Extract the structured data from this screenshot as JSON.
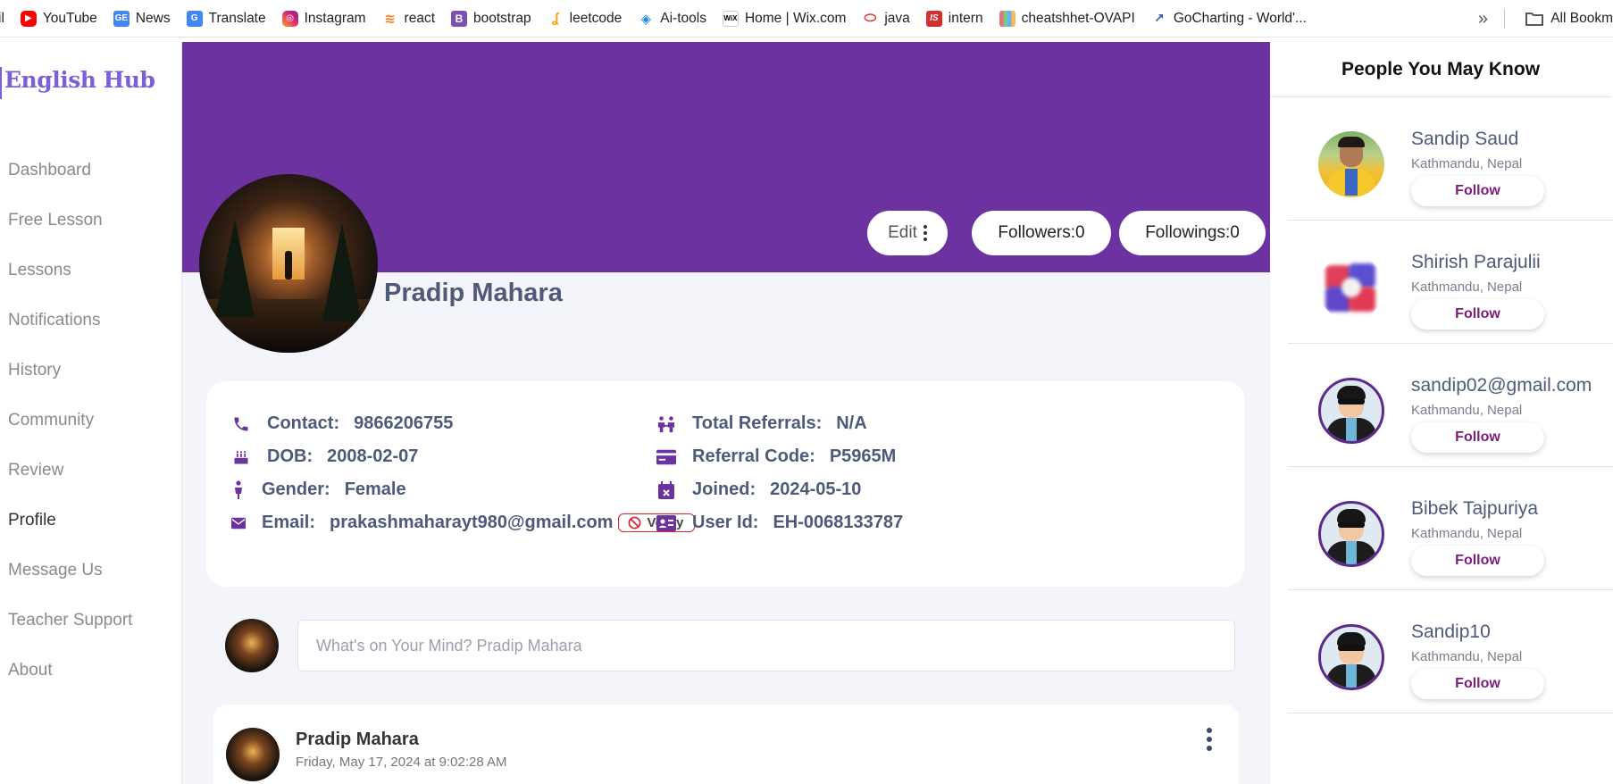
{
  "bookmarks": {
    "items": [
      {
        "label": "il",
        "icon": "mail-icon"
      },
      {
        "label": "YouTube",
        "icon": "youtube-icon",
        "color": "#ff0000"
      },
      {
        "label": "News",
        "icon": "news-icon",
        "color": "#4285f4"
      },
      {
        "label": "Translate",
        "icon": "translate-icon",
        "color": "#4285f4"
      },
      {
        "label": "Instagram",
        "icon": "instagram-icon",
        "color": "#e1306c"
      },
      {
        "label": "react",
        "icon": "stackoverflow-icon",
        "color": "#f48024"
      },
      {
        "label": "bootstrap",
        "icon": "bootstrap-icon",
        "color": "#7952b3"
      },
      {
        "label": "leetcode",
        "icon": "leetcode-icon",
        "color": "#ffa116"
      },
      {
        "label": "Ai-tools",
        "icon": "diamond-icon",
        "color": "#1e88e5"
      },
      {
        "label": "Home | Wix.com",
        "icon": "wix-icon",
        "color": "#000000"
      },
      {
        "label": "java",
        "icon": "oracle-icon",
        "color": "#e53935"
      },
      {
        "label": "intern",
        "icon": "is-icon",
        "color": "#d32f2f"
      },
      {
        "label": "cheatshhet-OVAPI",
        "icon": "bars-icon",
        "color": "#8e6c3f"
      },
      {
        "label": "GoCharting - World'...",
        "icon": "chart-icon",
        "color": "#3f51b5"
      }
    ],
    "all_bookmarks": "All Bookm"
  },
  "sidebar": {
    "logo": "English Hub",
    "items": [
      {
        "label": "Dashboard"
      },
      {
        "label": "Free Lesson"
      },
      {
        "label": "Lessons"
      },
      {
        "label": "Notifications"
      },
      {
        "label": "History"
      },
      {
        "label": "Community"
      },
      {
        "label": "Review"
      },
      {
        "label": "Profile",
        "active": true
      },
      {
        "label": "Message Us"
      },
      {
        "label": "Teacher Support"
      },
      {
        "label": "About"
      }
    ]
  },
  "profile": {
    "name": "Pradip Mahara",
    "edit_label": "Edit",
    "followers_label": "Followers:0",
    "followings_label": "Followings:0",
    "banner_color": "#6b32a0"
  },
  "info": {
    "contact": {
      "label": "Contact:",
      "value": "9866206755"
    },
    "dob": {
      "label": "DOB:",
      "value": "2008-02-07"
    },
    "gender": {
      "label": "Gender:",
      "value": "Female"
    },
    "email": {
      "label": "Email:",
      "value": "prakashmaharayt980@gmail.com"
    },
    "verify": "Verify",
    "referrals": {
      "label": "Total Referrals:",
      "value": "N/A"
    },
    "referral_code": {
      "label": "Referral Code:",
      "value": "P5965M"
    },
    "joined": {
      "label": "Joined:",
      "value": "2024-05-10"
    },
    "user_id": {
      "label": "User Id:",
      "value": "EH-0068133787"
    },
    "icon_color": "#6b32a0"
  },
  "composer": {
    "placeholder": "What's on Your Mind? Pradip Mahara"
  },
  "post": {
    "author": "Pradip Mahara",
    "time": "Friday, May 17, 2024 at 9:02:28 AM"
  },
  "people": {
    "title": "People You May Know",
    "follow_label": "Follow",
    "items": [
      {
        "name": "Sandip Saud",
        "location": "Kathmandu, Nepal"
      },
      {
        "name": "Shirish Parajulii",
        "location": "Kathmandu, Nepal"
      },
      {
        "name": "sandip02@gmail.com",
        "location": "Kathmandu, Nepal"
      },
      {
        "name": "Bibek Tajpuriya",
        "location": "Kathmandu, Nepal"
      },
      {
        "name": "Sandip10",
        "location": "Kathmandu, Nepal"
      }
    ]
  }
}
